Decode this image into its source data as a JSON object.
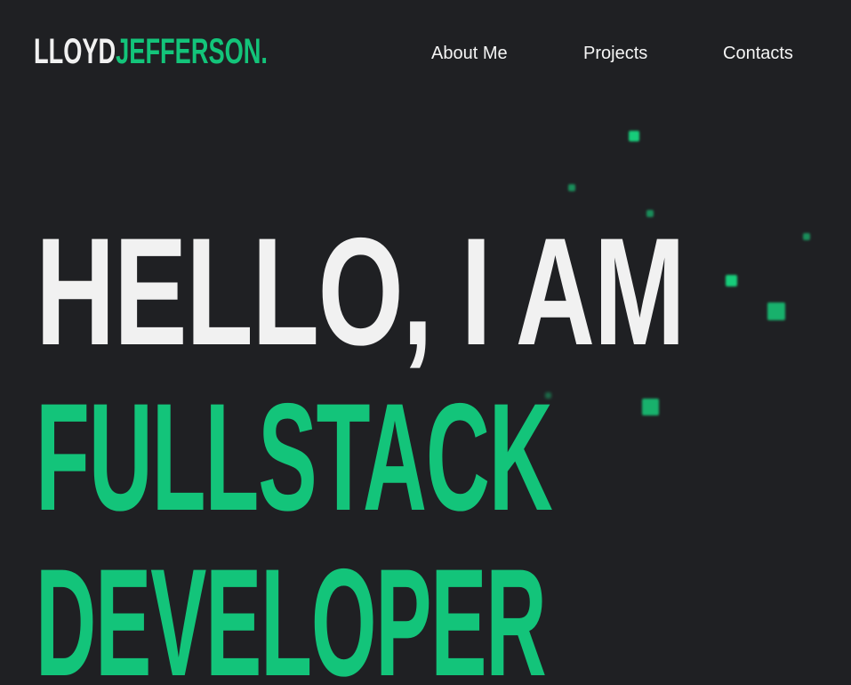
{
  "header": {
    "logo_first": "LLOYD",
    "logo_last": "JEFFERSON.",
    "nav": [
      {
        "label": "About Me"
      },
      {
        "label": "Projects"
      },
      {
        "label": "Contacts"
      }
    ]
  },
  "hero": {
    "line1": "HELLO, I AM",
    "line2": "FULLSTACK",
    "line3": "DEVELOPER"
  },
  "colors": {
    "background": "#1f2023",
    "accent": "#13c47a",
    "text": "#f1f1f1"
  }
}
